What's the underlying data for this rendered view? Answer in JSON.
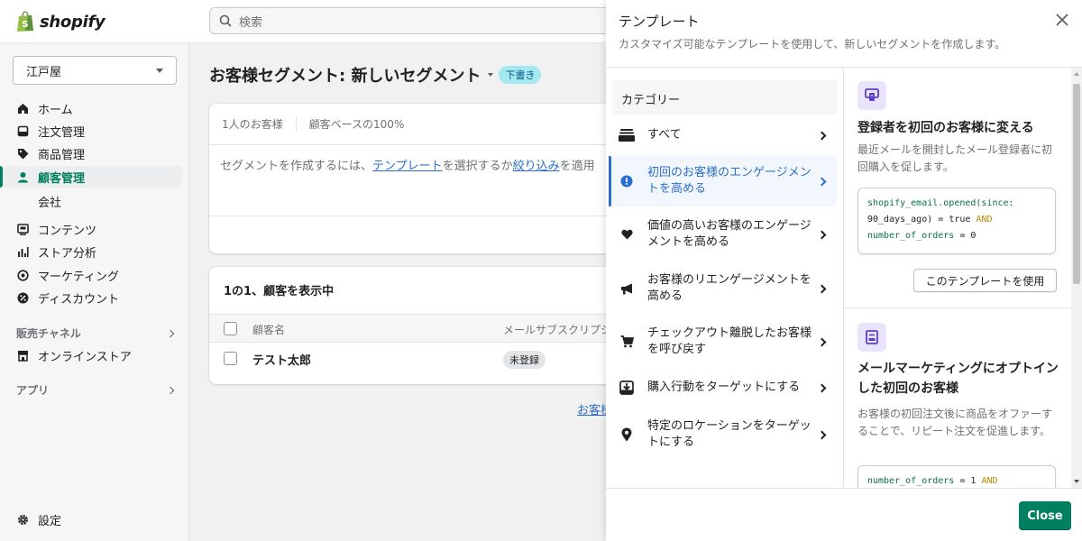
{
  "app": {
    "logo_text": "shopify"
  },
  "topbar": {
    "search_placeholder": "検索"
  },
  "sidebar": {
    "store_name": "江戸屋",
    "items": [
      {
        "label": "ホーム",
        "icon": "home-icon"
      },
      {
        "label": "注文管理",
        "icon": "orders-icon"
      },
      {
        "label": "商品管理",
        "icon": "tag-icon"
      },
      {
        "label": "顧客管理",
        "icon": "person-icon"
      },
      {
        "label": "コンテンツ",
        "icon": "content-icon"
      },
      {
        "label": "ストア分析",
        "icon": "bar-chart-icon"
      },
      {
        "label": "マーケティング",
        "icon": "target-icon"
      },
      {
        "label": "ディスカウント",
        "icon": "discount-icon"
      },
      {
        "label": "オンラインストア",
        "icon": "store-icon"
      }
    ],
    "sub_company": "会社",
    "sales_channels": "販売チャネル",
    "apps": "アプリ",
    "settings": "設定"
  },
  "main": {
    "title": "お客様セグメント: 新しいセグメント",
    "draft_badge": "下書き",
    "stat_customers": "1人のお客様",
    "stat_base": "顧客ベースの100%",
    "hint_prefix": "セグメントを作成するには、",
    "hint_link_template": "テンプレート",
    "hint_mid": "を選択するか",
    "hint_link_filter": "絞り込み",
    "hint_suffix": "を適用",
    "list_title": "1の1、顧客を表示中",
    "col_name": "顧客名",
    "col_email": "メールサブスクリプション",
    "row_name": "テスト太郎",
    "row_status": "未登録",
    "bottom_link": "お客様"
  },
  "panel": {
    "title": "テンプレート",
    "subtitle": "カスタマイズ可能なテンプレートを使用して、新しいセグメントを作成します。",
    "category_header": "カテゴリー",
    "categories": [
      {
        "label": "すべて",
        "icon": "stack-icon"
      },
      {
        "label": "初回のお客様のエンゲージメントを高める",
        "icon": "alert-circle-icon"
      },
      {
        "label": "価値の高いお客様のエンゲージメントを高める",
        "icon": "heart-icon"
      },
      {
        "label": "お客様のリエンゲージメントを高める",
        "icon": "megaphone-icon"
      },
      {
        "label": "チェックアウト離脱したお客様を呼び戻す",
        "icon": "cart-icon"
      },
      {
        "label": "購入行動をターゲットにする",
        "icon": "download-box-icon"
      },
      {
        "label": "特定のロケーションをターゲットにする",
        "icon": "location-pin-icon"
      }
    ],
    "templates": [
      {
        "title": "登録者を初回のお客様に変える",
        "desc": "最近メールを開封したメール登録者に初回購入を促します。",
        "code_1a": "shopify_email.opened(since:",
        "code_2a": "90_days_ago)",
        "code_2b": " = ",
        "code_2c": "true",
        "code_2d": " AND",
        "code_3a": "number_of_orders",
        "code_3b": " = ",
        "code_3c": "0",
        "use_button": "このテンプレートを使用"
      },
      {
        "title": "メールマーケティングにオプトインした初回のお客様",
        "desc": "お客様の初回注文後に商品をオファーすることで、リピート注文を促進します。",
        "code_1a": "number_of_orders",
        "code_1b": " = ",
        "code_1c": "1",
        "code_1d": " AND"
      }
    ],
    "close_button": "Close"
  },
  "colors": {
    "primary": "#008060",
    "link": "#2c6ecb",
    "badge": "#a4e8f2"
  }
}
